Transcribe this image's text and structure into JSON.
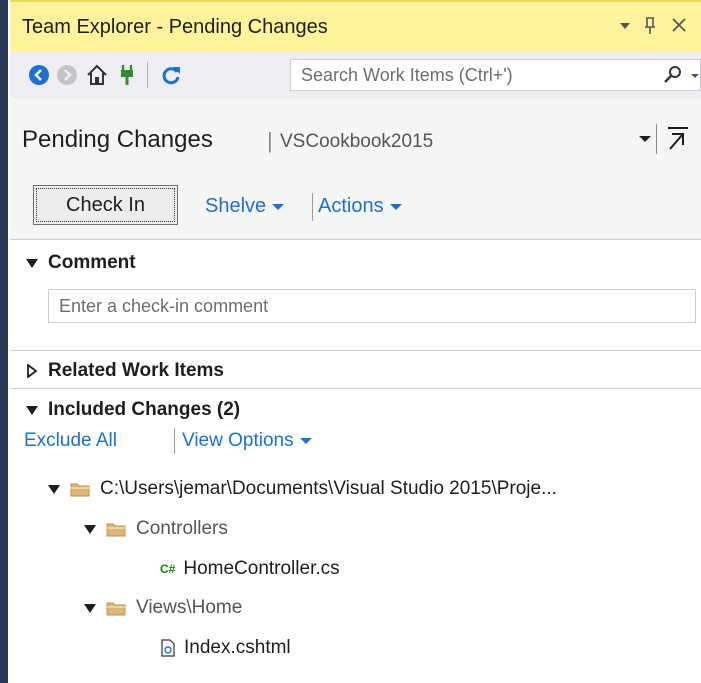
{
  "window": {
    "title": "Team Explorer - Pending Changes"
  },
  "titlebar_buttons": [
    "dropdown-arrow",
    "pin-icon",
    "close-icon"
  ],
  "toolbar": {
    "search_placeholder": "Search Work Items (Ctrl+')",
    "icons": [
      "back-icon",
      "forward-icon",
      "home-icon",
      "connect-icon",
      "refresh-icon",
      "search-icon"
    ]
  },
  "header": {
    "page_title": "Pending Changes",
    "separator": "|",
    "project": "VSCookbook2015"
  },
  "actions": {
    "check_in": "Check In",
    "shelve": "Shelve",
    "actions": "Actions"
  },
  "comment": {
    "title": "Comment",
    "placeholder": "Enter a check-in comment"
  },
  "related": {
    "title": "Related Work Items"
  },
  "included": {
    "title": "Included Changes (2)",
    "exclude_all": "Exclude All",
    "view_options": "View Options"
  },
  "tree": {
    "root": "C:\\Users\\jemar\\Documents\\Visual Studio 2015\\Proje...",
    "folder1": "Controllers",
    "file1_badge": "C#",
    "file1": "HomeController.cs",
    "folder2": "Views\\Home",
    "file2": "Index.cshtml"
  },
  "colors": {
    "titlebar": "#fff29d",
    "link": "#1e6fd0",
    "toolbar": "#eeeef2",
    "folder": "#dcb67a"
  }
}
